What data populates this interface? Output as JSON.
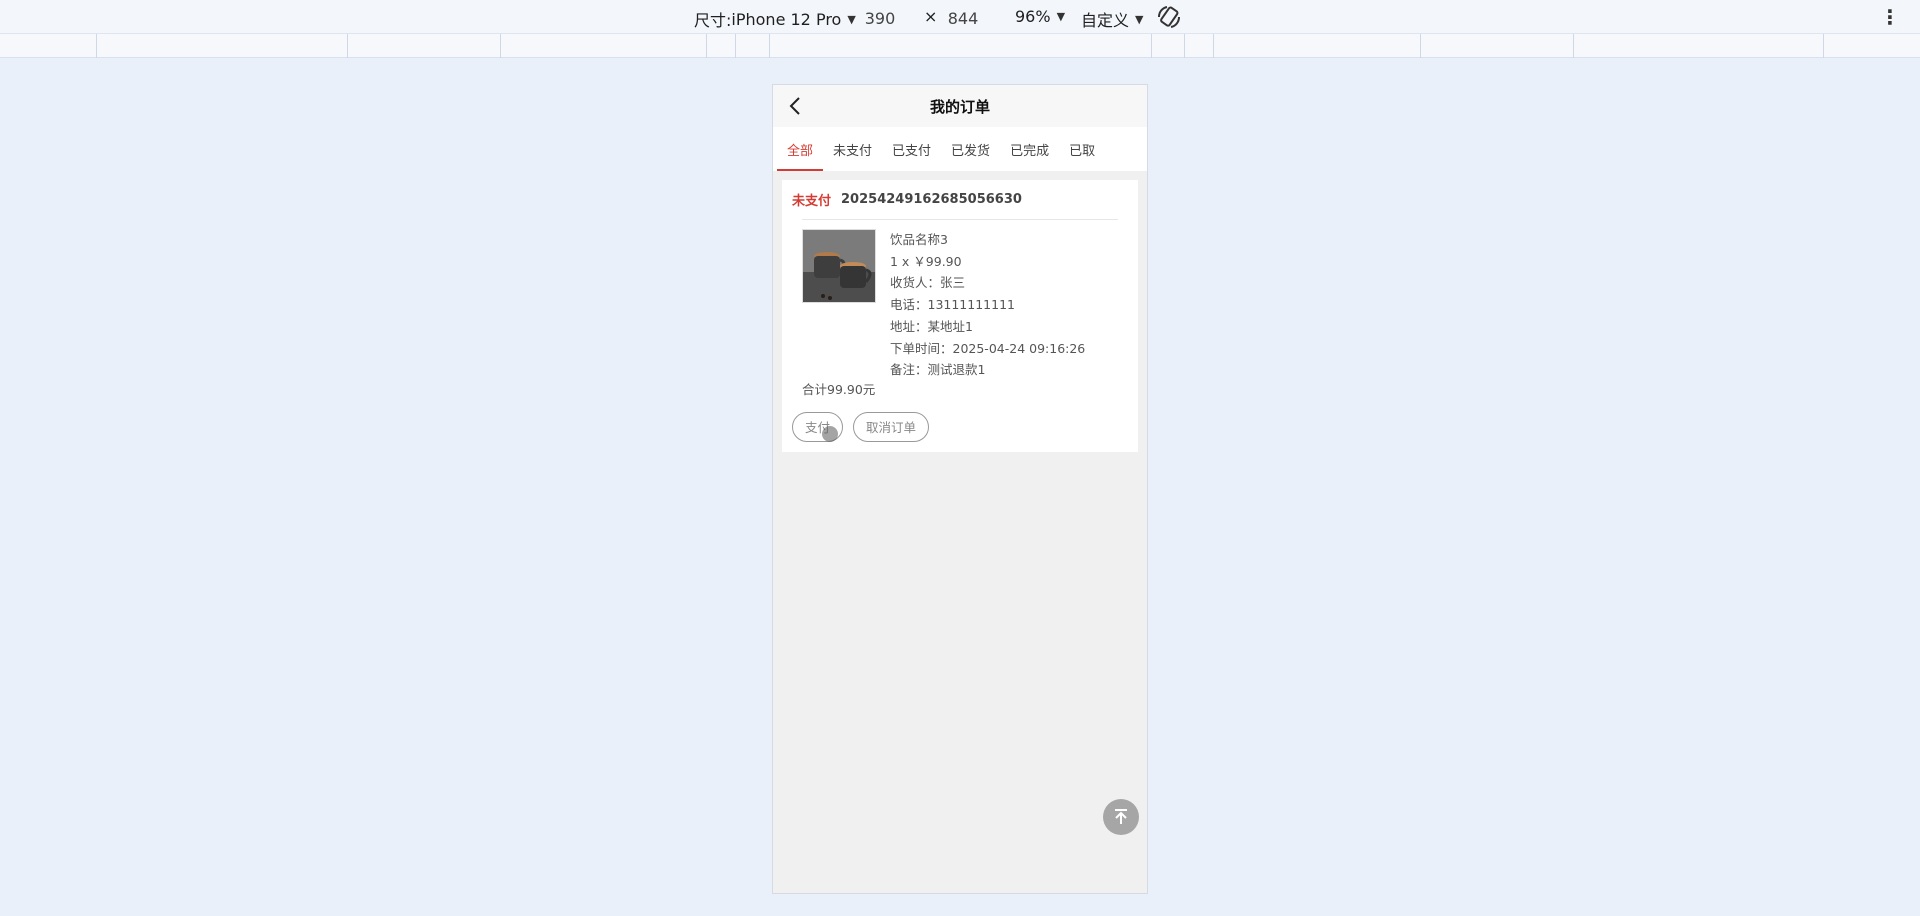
{
  "devtools": {
    "device_prefix": "尺寸: ",
    "device_name": "iPhone 12 Pro",
    "width": "390",
    "times": "×",
    "height": "844",
    "zoom": "96%",
    "mode": "自定义"
  },
  "app": {
    "title": "我的订单",
    "tabs": [
      "全部",
      "未支付",
      "已支付",
      "已发货",
      "已完成",
      "已取"
    ],
    "active_tab": 0,
    "accent": "#d43c33"
  },
  "order": {
    "status": "未支付",
    "order_no": "20254249162685056630",
    "item_name": "饮品名称3",
    "qty_price": "1 x ￥99.90",
    "receiver": "收货人：张三",
    "phone": "电话：13111111111",
    "address": "地址：某地址1",
    "order_time": "下单时间：2025-04-24 09:16:26",
    "remark": "备注：测试退款1",
    "total": "合计99.90元",
    "pay_label": "支付",
    "cancel_label": "取消订单"
  },
  "icons": {
    "back": "chevron-left-icon",
    "to_top": "arrow-up-to-line-icon",
    "rotate": "rotate-device-icon",
    "more": "kebab-menu-icon"
  }
}
